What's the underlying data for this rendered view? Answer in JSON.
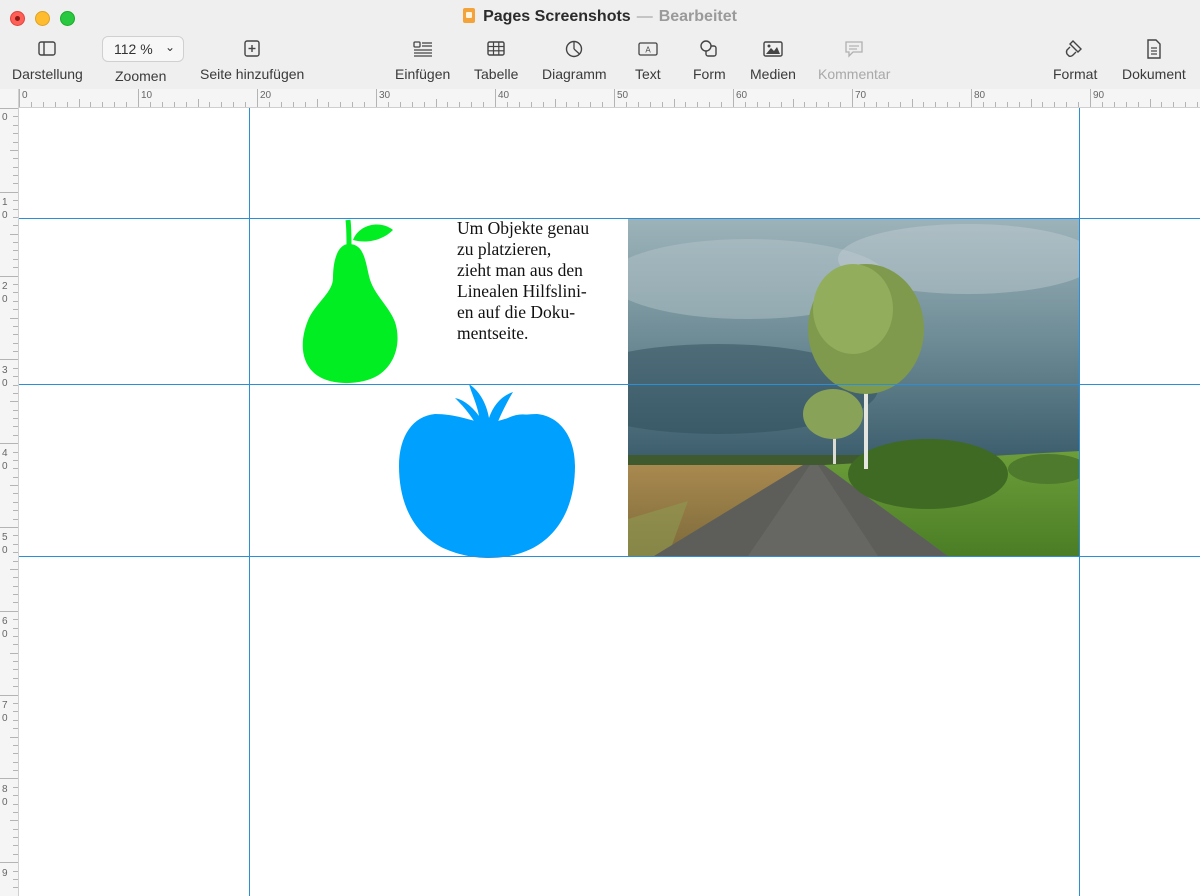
{
  "window": {
    "title": "Pages Screenshots",
    "separator": "—",
    "status": "Bearbeitet"
  },
  "toolbar": {
    "view": "Darstellung",
    "zoom_value": "112 %",
    "zoom_label": "Zoomen",
    "add_page": "Seite hinzufügen",
    "insert": "Einfügen",
    "table": "Tabelle",
    "chart": "Diagramm",
    "text": "Text",
    "shape": "Form",
    "media": "Medien",
    "comment": "Kommentar",
    "format": "Format",
    "document": "Dokument"
  },
  "ruler": {
    "h_labels": [
      "0",
      "10",
      "20",
      "30",
      "40",
      "50",
      "60",
      "70",
      "80",
      "90"
    ],
    "v_labels": [
      "0",
      "1\n0",
      "2\n0",
      "3\n0",
      "4\n0",
      "5\n0",
      "6\n0",
      "7\n0",
      "8\n0",
      "9"
    ]
  },
  "document": {
    "body_text": "Um Objekte genau\nzu platzieren,\nzieht man aus den\nLinealen Hilfslini-\nen auf die Doku-\nmentseite."
  },
  "colors": {
    "guide": "#2a8fd6",
    "pear": "#00ee22",
    "tomato": "#00a0ff"
  },
  "icons": {
    "pear": "pear-shape",
    "tomato": "tomato-shape",
    "photo": "landscape-photo"
  }
}
